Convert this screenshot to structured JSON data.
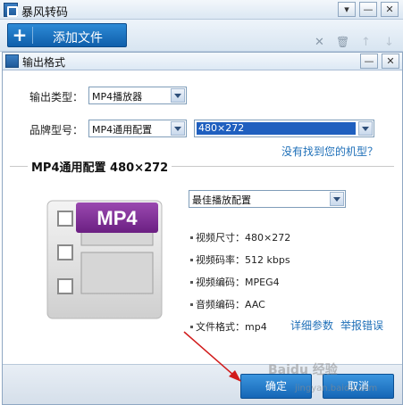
{
  "app": {
    "title": "暴风转码",
    "window_buttons": {
      "menu": "▾",
      "minimize": "—",
      "close": "✕"
    },
    "toolbar": {
      "add_file_label": "添加文件",
      "add_file_icon": "+",
      "icons": {
        "remove": "✕",
        "delete": "🗑",
        "move_up": "↑",
        "move_down": "↓"
      }
    }
  },
  "dialog": {
    "title": "输出格式",
    "window_buttons": {
      "minimize": "—",
      "close": "✕"
    },
    "output_type": {
      "label": "输出类型：",
      "value": "MP4播放器"
    },
    "brand_model": {
      "label": "品牌型号：",
      "brand_value": "MP4通用配置",
      "model_value": "480×272"
    },
    "no_model_link": "没有找到您的机型？",
    "section_title": "MP4通用配置  480×272",
    "preset": {
      "value": "最佳播放配置"
    },
    "format_badge": "MP4",
    "specs": [
      {
        "label": "视频尺寸：",
        "value": "480×272"
      },
      {
        "label": "视频码率：",
        "value": "512 kbps"
      },
      {
        "label": "视频编码：",
        "value": "MPEG4"
      },
      {
        "label": "音频编码：",
        "value": "AAC"
      },
      {
        "label": "文件格式：",
        "value": "mp4"
      }
    ],
    "details_link": "详细参数",
    "report_link": "举报错误",
    "ok_button": "确定",
    "cancel_button": "取消"
  },
  "watermark": {
    "text": "Baidu 经验",
    "url": "jingyan.baidu.com"
  },
  "colors": {
    "accent": "#1566b6",
    "link": "#1e6fb8",
    "arrow": "#d11a1a",
    "badge": "#7b2c8f"
  }
}
